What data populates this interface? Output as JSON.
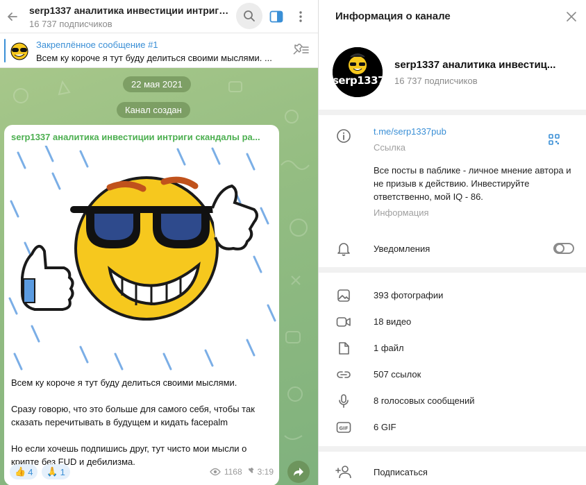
{
  "chat": {
    "title": "serp1337 аналитика инвестиции интриги с...",
    "subscribers": "16 737 подписчиков",
    "pinned": {
      "title": "Закреплённое сообщение #1",
      "text": "Всем ку короче я тут буду делиться своими мыслями. ..."
    },
    "date_chip": "22 мая 2021",
    "created_chip": "Канал создан",
    "post": {
      "author": "serp1337 аналитика инвестиции интриги скандалы ра...",
      "paragraphs": [
        "Всем ку короче я тут буду делиться своими мыслями.",
        "Сразу говорю, что это больше для самого себя, чтобы так сказать перечитывать в будущем и кидать facepalm",
        "Но если хочешь подпишись друг, тут чисто мои мысли о крипте без FUD и дебилизма."
      ],
      "reactions": [
        {
          "emoji": "👍",
          "count": "4"
        },
        {
          "emoji": "🙏",
          "count": "1"
        }
      ],
      "views": "1168",
      "time": "3:19"
    },
    "icons": [
      "back-arrow-icon",
      "search-icon",
      "side-panel-icon",
      "more-vertical-icon",
      "pin-list-icon",
      "share-arrow-icon",
      "eye-icon",
      "pin-icon"
    ]
  },
  "info": {
    "header_title": "Информация о канале",
    "channel_name": "serp1337 аналитика инвестиц...",
    "subscribers": "16 737 подписчиков",
    "avatar_text": "serp1337",
    "link": "t.me/serp1337pub",
    "link_label": "Ссылка",
    "description": "Все посты в паблике - личное мнение автора и не призыв к действию. Инвестируйте ответственно, мой IQ - 86.",
    "description_label": "Информация",
    "notifications_label": "Уведомления",
    "notifications_on": false,
    "media": [
      {
        "label": "393 фотографии",
        "icon": "photo-icon"
      },
      {
        "label": "18 видео",
        "icon": "video-icon"
      },
      {
        "label": "1 файл",
        "icon": "file-icon"
      },
      {
        "label": "507 ссылок",
        "icon": "link-icon"
      },
      {
        "label": "8 голосовых сообщений",
        "icon": "microphone-icon"
      },
      {
        "label": "6 GIF",
        "icon": "gif-icon"
      }
    ],
    "subscribe_label": "Подписаться"
  },
  "colors": {
    "accent": "#3a8fd6",
    "author_green": "#4caf50",
    "chat_bg": "#94bd82"
  }
}
